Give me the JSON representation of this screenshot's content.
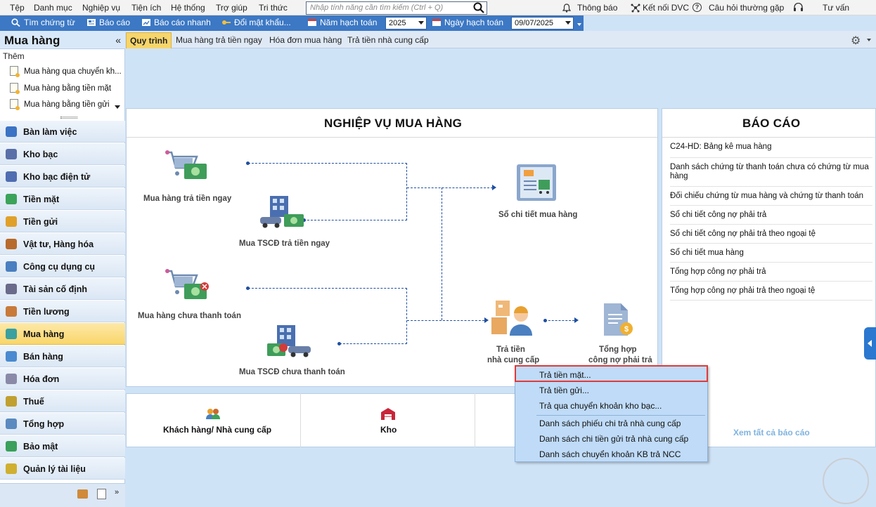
{
  "menubar": {
    "items": [
      "Tệp",
      "Danh mục",
      "Nghiệp vụ",
      "Tiện ích",
      "Hệ thống",
      "Trợ giúp",
      "Tri thức"
    ],
    "search_placeholder": "Nhập tính năng cần tìm kiếm (Ctrl + Q)",
    "right": {
      "notifications": "Thông báo",
      "connect": "Kết nối DVC",
      "faq": "Câu hỏi thường gặp",
      "advisor": "Tư vấn"
    }
  },
  "toolbar": {
    "find_voucher": "Tìm chứng từ",
    "report": "Báo cáo",
    "quick_report": "Báo cáo nhanh",
    "change_password": "Đổi mật khẩu...",
    "fiscal_year_label": "Năm hạch toán",
    "fiscal_year_value": "2025",
    "posting_date_label": "Ngày hạch toán",
    "posting_date_value": "09/07/2025"
  },
  "sidebar": {
    "title": "Mua hàng",
    "add_label": "Thêm",
    "quick_links": [
      "Mua hàng qua chuyển kh...",
      "Mua hàng bằng tiền mặt",
      "Mua hàng bằng tiền gửi"
    ],
    "nav": [
      {
        "label": "Bàn làm việc",
        "color": "#3b73c5"
      },
      {
        "label": "Kho bạc",
        "color": "#5a6fa8"
      },
      {
        "label": "Kho bạc điện tử",
        "color": "#4f6db0"
      },
      {
        "label": "Tiền mặt",
        "color": "#3ca35a"
      },
      {
        "label": "Tiền gửi",
        "color": "#e0a12a"
      },
      {
        "label": "Vật tư, Hàng hóa",
        "color": "#b86a2c"
      },
      {
        "label": "Công cụ dụng cụ",
        "color": "#4a7fc0"
      },
      {
        "label": "Tài sản cố định",
        "color": "#6a6a8a"
      },
      {
        "label": "Tiền lương",
        "color": "#c87a3a"
      },
      {
        "label": "Mua hàng",
        "color": "#3aa0a0",
        "active": true
      },
      {
        "label": "Bán hàng",
        "color": "#4a8ad0"
      },
      {
        "label": "Hóa đơn",
        "color": "#8a8aa8"
      },
      {
        "label": "Thuế",
        "color": "#c0a030"
      },
      {
        "label": "Tổng hợp",
        "color": "#5a8ac0"
      },
      {
        "label": "Bảo mật",
        "color": "#3aa05a"
      },
      {
        "label": "Quản lý tài liệu",
        "color": "#d0b030"
      }
    ]
  },
  "tabs": [
    "Quy trình",
    "Mua hàng trả tiền ngay",
    "Hóa đơn mua hàng",
    "Trả tiền nhà cung cấp"
  ],
  "workflow": {
    "title": "NGHIỆP VỤ MUA HÀNG",
    "nodes": {
      "buy_pay_now": "Mua hàng trả tiền ngay",
      "asset_pay_now": "Mua TSCĐ trả tiền ngay",
      "purchase_ledger": "Sổ chi tiết mua hàng",
      "buy_unpaid": "Mua hàng chưa thanh toán",
      "asset_unpaid": "Mua TSCĐ chưa thanh toán",
      "pay_supplier_line1": "Trả tiền",
      "pay_supplier_line2": "nhà cung cấp",
      "payables_line1": "Tổng hợp",
      "payables_line2": "công nợ phải trả"
    }
  },
  "reports": {
    "title": "BÁO CÁO",
    "items": [
      "C24-HD: Bảng kê mua hàng",
      "Danh sách chứng từ thanh toán chưa có chứng từ mua hàng",
      "Đối chiếu chứng từ mua hàng và chứng từ thanh toán",
      "Sổ chi tiết công nợ phải trả",
      "Sổ chi tiết công nợ phải trả theo ngoại tệ",
      "Sổ chi tiết mua hàng",
      "Tổng hợp công nợ phải trả",
      "Tổng hợp công nợ phải trả theo ngoại tệ"
    ],
    "see_all": "Xem tất cả báo cáo"
  },
  "bottom": {
    "customers_suppliers": "Khách hàng/ Nhà cung cấp",
    "warehouse": "Kho"
  },
  "context_menu": {
    "items": [
      "Trả tiền mặt...",
      "Trả tiền gửi...",
      "Trả qua chuyển khoản kho bạc...",
      "Danh sách phiếu chi trả nhà cung cấp",
      "Danh sách chi tiền gửi trả nhà cung cấp",
      "Danh sách chuyển khoản KB trả NCC"
    ],
    "highlighted": "Trả tiền mặt..."
  }
}
